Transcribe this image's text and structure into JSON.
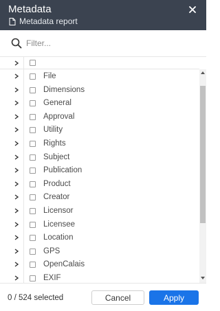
{
  "header": {
    "title": "Metadata",
    "subtitle": "Metadata report",
    "close_icon": "close-icon",
    "doc_icon": "document-icon"
  },
  "search": {
    "placeholder": "Filter...",
    "value": "",
    "icon": "search-icon"
  },
  "tree": {
    "items": [
      {
        "label": "File"
      },
      {
        "label": "Dimensions"
      },
      {
        "label": "General"
      },
      {
        "label": "Approval"
      },
      {
        "label": "Utility"
      },
      {
        "label": "Rights"
      },
      {
        "label": "Subject"
      },
      {
        "label": "Publication"
      },
      {
        "label": "Product"
      },
      {
        "label": "Creator"
      },
      {
        "label": "Licensor"
      },
      {
        "label": "Licensee"
      },
      {
        "label": "Location"
      },
      {
        "label": "GPS"
      },
      {
        "label": "OpenCalais"
      },
      {
        "label": "EXIF"
      }
    ]
  },
  "footer": {
    "status": "0 / 524 selected",
    "cancel_label": "Cancel",
    "apply_label": "Apply"
  },
  "colors": {
    "header_bg": "#3b4350",
    "accent": "#1a74e8"
  }
}
